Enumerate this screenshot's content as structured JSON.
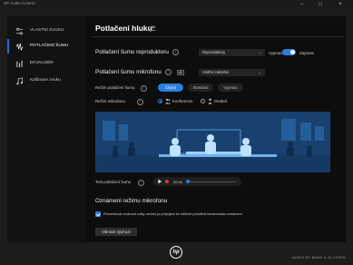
{
  "window": {
    "title": "HP Audio Control",
    "minimize": "–",
    "maximize": "□",
    "close": "×"
  },
  "sidebar": {
    "items": [
      {
        "label": "VLASTNÍ ZVUKU",
        "icon": "sliders-icon",
        "active": false
      },
      {
        "label": "POTLAČENÍ ŠUMU",
        "icon": "noise-wave-icon",
        "active": true
      },
      {
        "label": "EKVALIZÉR",
        "icon": "equalizer-icon",
        "active": false
      },
      {
        "label": "Kalibrace zvuku",
        "icon": "music-note-icon",
        "active": false
      }
    ]
  },
  "main": {
    "title": "Potlačení hluku",
    "speaker": {
      "label": "Potlačení šumu reproduktoru",
      "info": "i",
      "device": "Reproduktory",
      "state_off": "Vypnuto",
      "state_on": "Zapnuto",
      "enabled": true
    },
    "mic": {
      "label": "Potlačení šumu mikrofonu",
      "badge": "AI",
      "device": "Vnitřní mikrofon",
      "mode_label": "Režim potlačení šumu",
      "modes": [
        "Chytrý",
        "Standard",
        "Vypnuto"
      ],
      "selected_mode": "Chytrý",
      "mic_mode_label": "Režim mikrofonu",
      "mic_modes": [
        "Konference",
        "Osobní"
      ],
      "selected_mic_mode": "Konference"
    },
    "test": {
      "label": "Test potlačení šumu",
      "time": "00:00"
    },
    "notify": {
      "heading": "Oznámení režimu mikrofonu",
      "checkbox_label": "Prezentovat možnost volby režimu po připojení ke sdílené prostředí/obrazovkám oznámení",
      "checked": true
    },
    "reset_button": "Obnovit výchozí"
  },
  "footer": {
    "logo_text": "hp",
    "brand": "AUDIO BY BANG & OLUFSEN"
  },
  "colors": {
    "accent": "#2a7de1",
    "panel": "#0d0d0d",
    "scene": "#18416f"
  }
}
